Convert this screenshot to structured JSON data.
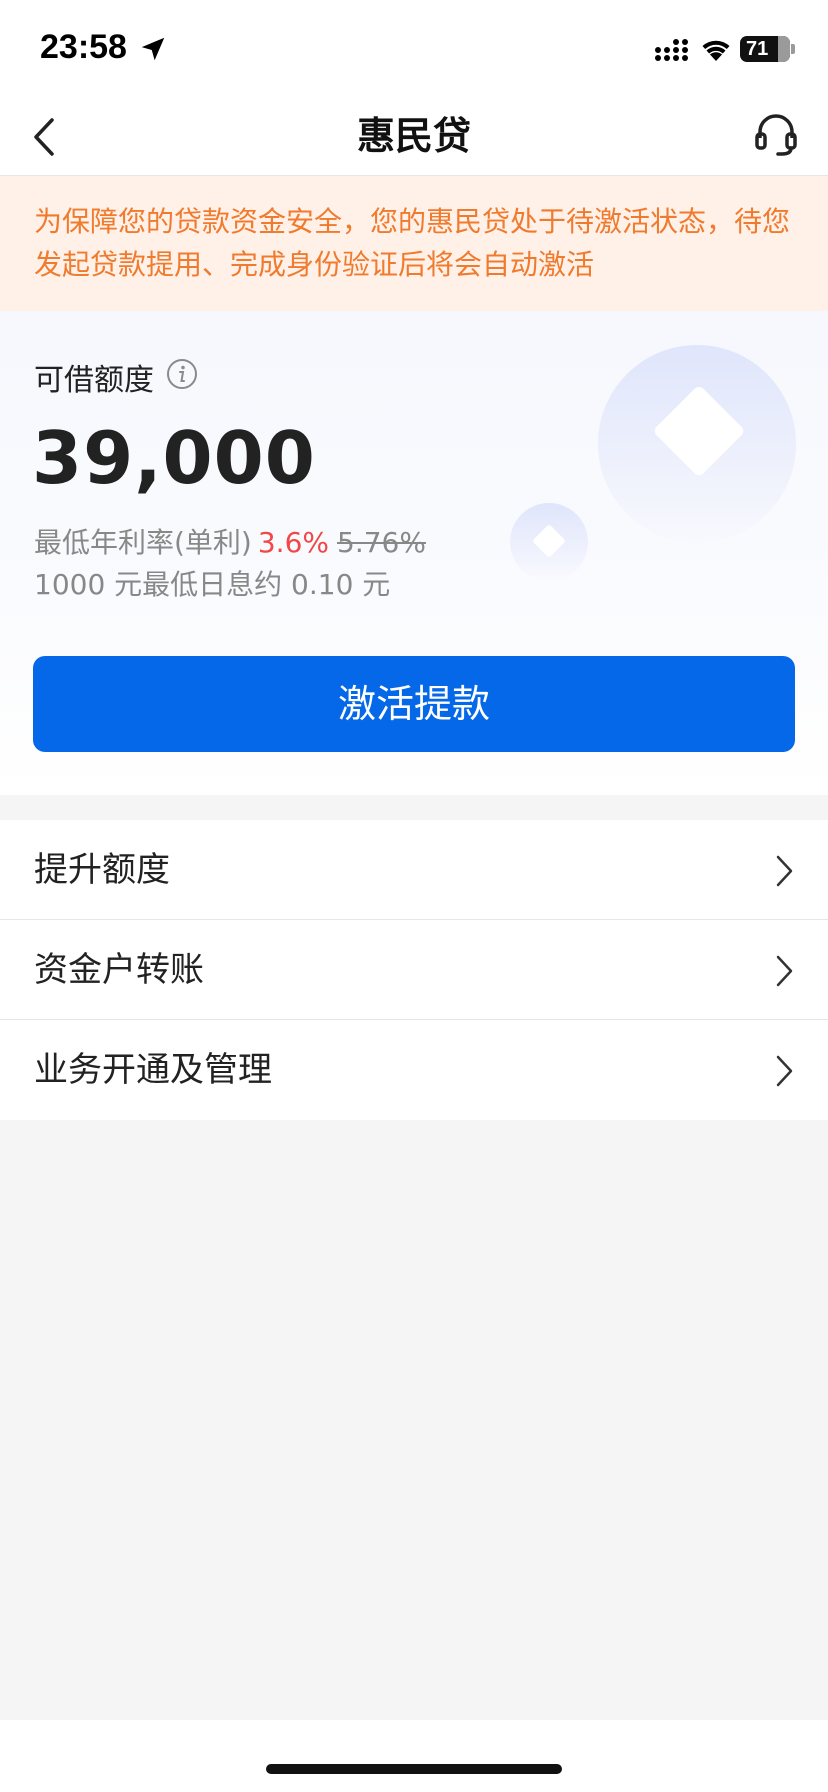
{
  "status_bar": {
    "time": "23:58",
    "battery": "71",
    "icons": [
      "location-arrow-icon",
      "signal-icon",
      "wifi-icon",
      "battery-icon"
    ]
  },
  "nav": {
    "title": "惠民贷",
    "back_icon": "chevron-left-icon",
    "service_icon": "headset-icon"
  },
  "notice": {
    "text": "为保障您的贷款资金安全，您的惠民贷处于待激活状态，待您发起贷款提用、完成身份验证后将会自动激活"
  },
  "credit": {
    "label": "可借额度",
    "info_icon": "info-icon",
    "amount": "39,000",
    "rate_prefix": "最低年利率(单利)",
    "rate_current": "3.6%",
    "rate_original": "5.76%",
    "interest_text": "1000 元最低日息约 0.10 元",
    "activate_button": "激活提款"
  },
  "menu": {
    "items": [
      {
        "label": "提升额度"
      },
      {
        "label": "资金户转账"
      },
      {
        "label": "业务开通及管理"
      }
    ]
  },
  "colors": {
    "primary": "#0568e8",
    "notice_text": "#f07a2d",
    "notice_bg": "#fff1e8",
    "rate_highlight": "#f04848"
  }
}
